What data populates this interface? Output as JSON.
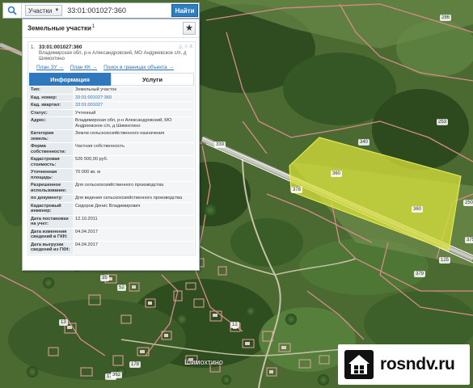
{
  "search": {
    "dropdown_label": "Участки",
    "query": "33:01:001027:360",
    "find_label": "Найти"
  },
  "panel": {
    "title": "Земельные участки",
    "title_count": "1",
    "star": "★",
    "card": {
      "number": "1.",
      "id": "33:01:001027:360",
      "address": "Владимирская обл, р-н Александровский, МО Андреевское с/п, д Шимохтино",
      "icons": "△ ☆ ≡",
      "links": [
        "План ЗУ →",
        "План КК →",
        "Поиск в границах объекта →"
      ]
    },
    "tabs": {
      "info": "Информация",
      "services": "Услуги"
    },
    "rows": [
      {
        "k": "Тип:",
        "v": "Земельный участок",
        "link": false
      },
      {
        "k": "Кад. номер:",
        "v": "33:01:001027:360",
        "link": true
      },
      {
        "k": "Кад. квартал:",
        "v": "33:01:001027",
        "link": true
      },
      {
        "k": "Статус:",
        "v": "Учтенный",
        "link": false
      },
      {
        "k": "Адрес:",
        "v": "Владимирская обл, р-н Александровский, МО Андреевское с/п, д Шимохтино",
        "link": false
      },
      {
        "k": "Категория земель:",
        "v": "Земли сельскохозяйственного назначения",
        "link": false
      },
      {
        "k": "Форма собственности:",
        "v": "Частная собственность",
        "link": false
      },
      {
        "k": "Кадастровая стоимость:",
        "v": "526 500,00 руб.",
        "link": false
      },
      {
        "k": "Уточненная площадь:",
        "v": "70 000 кв. м",
        "link": false
      },
      {
        "k": "Разрешенное использование:",
        "v": "Для сельскохозяйственного производства",
        "link": false
      },
      {
        "k": "по документу:",
        "v": "Для ведения сельскохозяйственного производства",
        "link": false
      },
      {
        "k": "Кадастровый инженер:",
        "v": "Сидоров Денис Владимирович",
        "link": false
      },
      {
        "k": "Дата постановки на учет:",
        "v": "12.10.2011",
        "link": false
      },
      {
        "k": "Дата изменения сведений в ГКН:",
        "v": "04.04.2017",
        "link": false
      },
      {
        "k": "Дата выгрузки сведений из ГКН:",
        "v": "04.04.2017",
        "link": false
      }
    ]
  },
  "map": {
    "parcel_labels": [
      "360",
      "340",
      "286",
      "253",
      "333",
      "378",
      "379",
      "375",
      "250",
      "125",
      "35",
      "52",
      "13",
      "178",
      "175",
      "12",
      "362"
    ],
    "village": "Шимохтино"
  },
  "logo": {
    "text": "rosndv.ru"
  }
}
